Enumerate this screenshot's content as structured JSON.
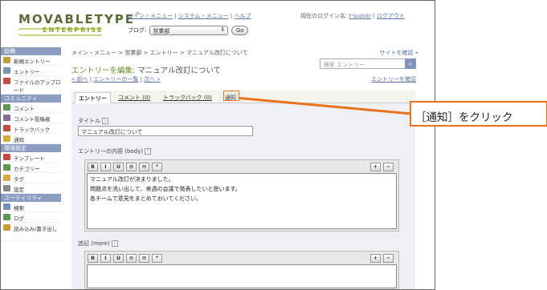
{
  "header": {
    "logo_main": "MOVABLETYPE",
    "logo_tm": "™",
    "logo_sub": "ENTERPRISE",
    "nav": [
      "メイン・メニュー",
      "システム・メニュー",
      "ヘルプ"
    ],
    "nav_sep": "|",
    "blog_label": "ブログ:",
    "blog_value": "営業部",
    "go_label": "Go",
    "login_prefix": "現在のログイン名:",
    "login_user": "t-suzuki",
    "logout": "ログアウト"
  },
  "sidebar": {
    "sections": [
      {
        "title": "投稿",
        "items": [
          {
            "label": "新規エントリー",
            "icon": "new-entry-icon",
            "color": "#c89a3a"
          },
          {
            "label": "エントリー",
            "icon": "entries-icon",
            "color": "#7a8fb8"
          },
          {
            "label": "ファイルのアップロード",
            "icon": "upload-icon",
            "color": "#c84a3a"
          }
        ]
      },
      {
        "title": "コミュニティ",
        "items": [
          {
            "label": "コメント",
            "icon": "comment-icon",
            "color": "#5a9a4a"
          },
          {
            "label": "コメント投稿者",
            "icon": "commenter-icon",
            "color": "#8a6a9a"
          },
          {
            "label": "トラックバック",
            "icon": "trackback-icon",
            "color": "#c84a3a"
          },
          {
            "label": "通知",
            "icon": "notification-icon",
            "color": "#d8a838"
          }
        ]
      },
      {
        "title": "環境設定",
        "items": [
          {
            "label": "テンプレート",
            "icon": "template-icon",
            "color": "#c84a3a"
          },
          {
            "label": "カテゴリー",
            "icon": "category-icon",
            "color": "#5a9a4a"
          },
          {
            "label": "タグ",
            "icon": "tag-icon",
            "color": "#d8a838"
          },
          {
            "label": "設定",
            "icon": "settings-icon",
            "color": "#888888"
          }
        ]
      },
      {
        "title": "ユーティリティ",
        "items": [
          {
            "label": "検索",
            "icon": "search-icon",
            "color": "#7a8fb8"
          },
          {
            "label": "ログ",
            "icon": "log-icon",
            "color": "#5a9a4a"
          },
          {
            "label": "読み込み/書き出し",
            "icon": "import-export-icon",
            "color": "#c89a3a"
          }
        ]
      }
    ]
  },
  "main": {
    "breadcrumb": "メイン・メニュー > 営業部 > エントリー > マニュアル改訂について",
    "site_link": "サイトを確認 »",
    "search_placeholder": "検索 エントリー",
    "title_prefix": "エントリーを編集:",
    "title_sub": "マニュアル改訂について",
    "prev": "« 前へ",
    "list": "エントリーの一覧",
    "next": "次へ »",
    "view_entry": "エントリーを確認",
    "tabs": [
      "エントリー",
      "コメント (0)",
      "トラックバック (0)",
      "通知"
    ],
    "title_label": "タイトル",
    "title_value": "マニュアル改訂について",
    "body_label": "エントリーの内容 (body)",
    "body_lines": [
      "マニュアル改訂が決まりました。",
      "問題点を洗い出して、来週の会議で発表したいと思います。",
      "各チームで意見をまとめておいてください。"
    ],
    "more_label": "追記 (more)",
    "help": "?",
    "toolbar": [
      "B",
      "I",
      "U",
      "⊖",
      "✉",
      "“"
    ]
  },
  "callout": {
    "text": "［通知］をクリック",
    "color": "#e8731c"
  }
}
